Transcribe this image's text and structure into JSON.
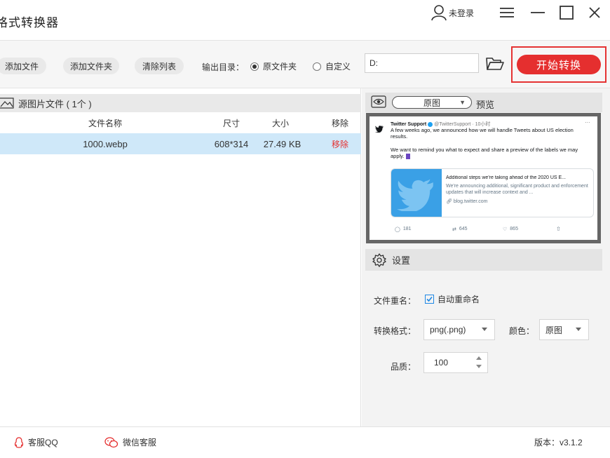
{
  "window": {
    "title": "格式转换器",
    "user_label": "未登录",
    "icons": [
      "user-icon",
      "menu-icon",
      "minimize-icon",
      "maximize-icon",
      "close-icon"
    ]
  },
  "toolbar": {
    "add_file": "添加文件",
    "add_folder": "添加文件夹",
    "clear_list": "清除列表",
    "output_dir_label": "输出目录：",
    "radio_original_folder": "原文件夹",
    "radio_custom": "自定义",
    "selected_output": "原文件夹",
    "output_path": "D:",
    "start_button": "开始转换"
  },
  "file_panel": {
    "title": "源图片文件 ( 1个 )",
    "columns": [
      "文件名称",
      "尺寸",
      "大小",
      "移除"
    ],
    "rows": [
      {
        "name": "1000.webp",
        "size": "608*314",
        "filesize": "27.49 KB",
        "remove": "移除"
      }
    ]
  },
  "preview": {
    "mode_select": "原图",
    "label": "预览",
    "tweet": {
      "author": "Twitter Support",
      "handle_time": "@TwitterSupport · 10小时",
      "text1": "A few weeks ago, we announced how we will handle Tweets about US election results.",
      "text2": "We want to remind you what to expect and share a preview of the labels we may apply.",
      "card_title": "Additional steps we're taking ahead of the 2020 US E...",
      "card_desc": "We're announcing additional, significant product and enforcement updates that will increase context and ...",
      "card_link": "blog.twitter.com",
      "replies": "181",
      "retweets": "645",
      "likes": "865"
    }
  },
  "settings": {
    "title": "设置",
    "rename_label": "文件重名：",
    "auto_rename": "自动重命名",
    "auto_rename_checked": true,
    "format_label": "转换格式：",
    "format_value": "png(.png)",
    "color_label": "颜色：",
    "color_value": "原图",
    "quality_label": "品质：",
    "quality_value": "100"
  },
  "footer": {
    "qq_support": "客服QQ",
    "wechat_support": "微信客服",
    "version": "版本：v3.1.2"
  },
  "colors": {
    "accent_red": "#e52f2f",
    "selected_row": "#cfe8f9",
    "twitter_blue": "#1da1f2"
  }
}
